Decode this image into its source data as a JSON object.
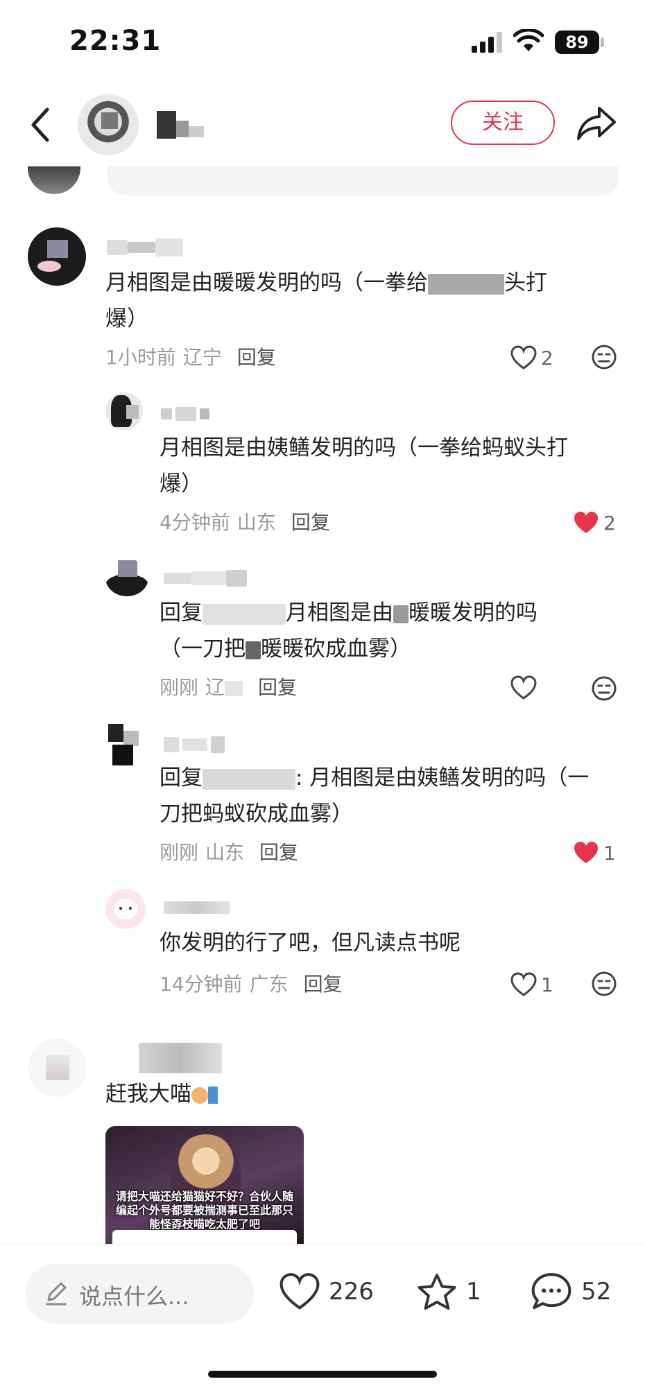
{
  "status_bar": {
    "time": "22:31",
    "battery": "89"
  },
  "header": {
    "follow_label": "关注"
  },
  "comments": [
    {
      "text": "月相图是由暖暖发明的吗（一拳给头打爆）",
      "text_line1": "月相图是由暖暖发明的吗（一拳给",
      "text_line1_tail": "头打",
      "text_line2": "爆）",
      "time": "1小时前",
      "region": "辽宁",
      "reply_label": "回复",
      "likes": "2",
      "liked": false
    },
    {
      "text_line1": "月相图是由姨鳝发明的吗（一拳给蚂蚁头打",
      "text_line2": "爆）",
      "time": "4分钟前",
      "region": "山东",
      "reply_label": "回复",
      "likes": "2",
      "liked": true
    },
    {
      "text_line1_a": "回复",
      "text_line1_b": "月相图是由",
      "text_line1_c": "暖暖发明的吗",
      "text_line2_a": "（一刀把",
      "text_line2_b": "暖暖砍成血雾）",
      "time": "刚刚",
      "region": "辽",
      "reply_label": "回复",
      "likes": "",
      "liked": false
    },
    {
      "text_line1_a": "回复",
      "text_line1_b": ": 月相图是由姨鳝发明的吗（一",
      "text_line2": "刀把蚂蚁砍成血雾）",
      "time": "刚刚",
      "region": "山东",
      "reply_label": "回复",
      "likes": "1",
      "liked": true
    },
    {
      "text_line1": "你发明的行了吧，但凡读点书呢",
      "time": "14分钟前",
      "region": "广东",
      "reply_label": "回复",
      "likes": "1",
      "liked": false
    },
    {
      "text_line1": "赶我大喵"
    }
  ],
  "image_card": {
    "overlay_text": "请把大喵还给猫猫好不好？合伙人随编起个外号都要被揣测事已至此那只能怪孬枝喵吃太肥了吧"
  },
  "bottom_bar": {
    "say_placeholder": "说点什么...",
    "likes": "226",
    "favorites": "1",
    "comments": "52"
  },
  "colors": {
    "accent": "#e3344d",
    "liked_heart": "#e8344a",
    "meta_gray": "#9a9a9a"
  }
}
